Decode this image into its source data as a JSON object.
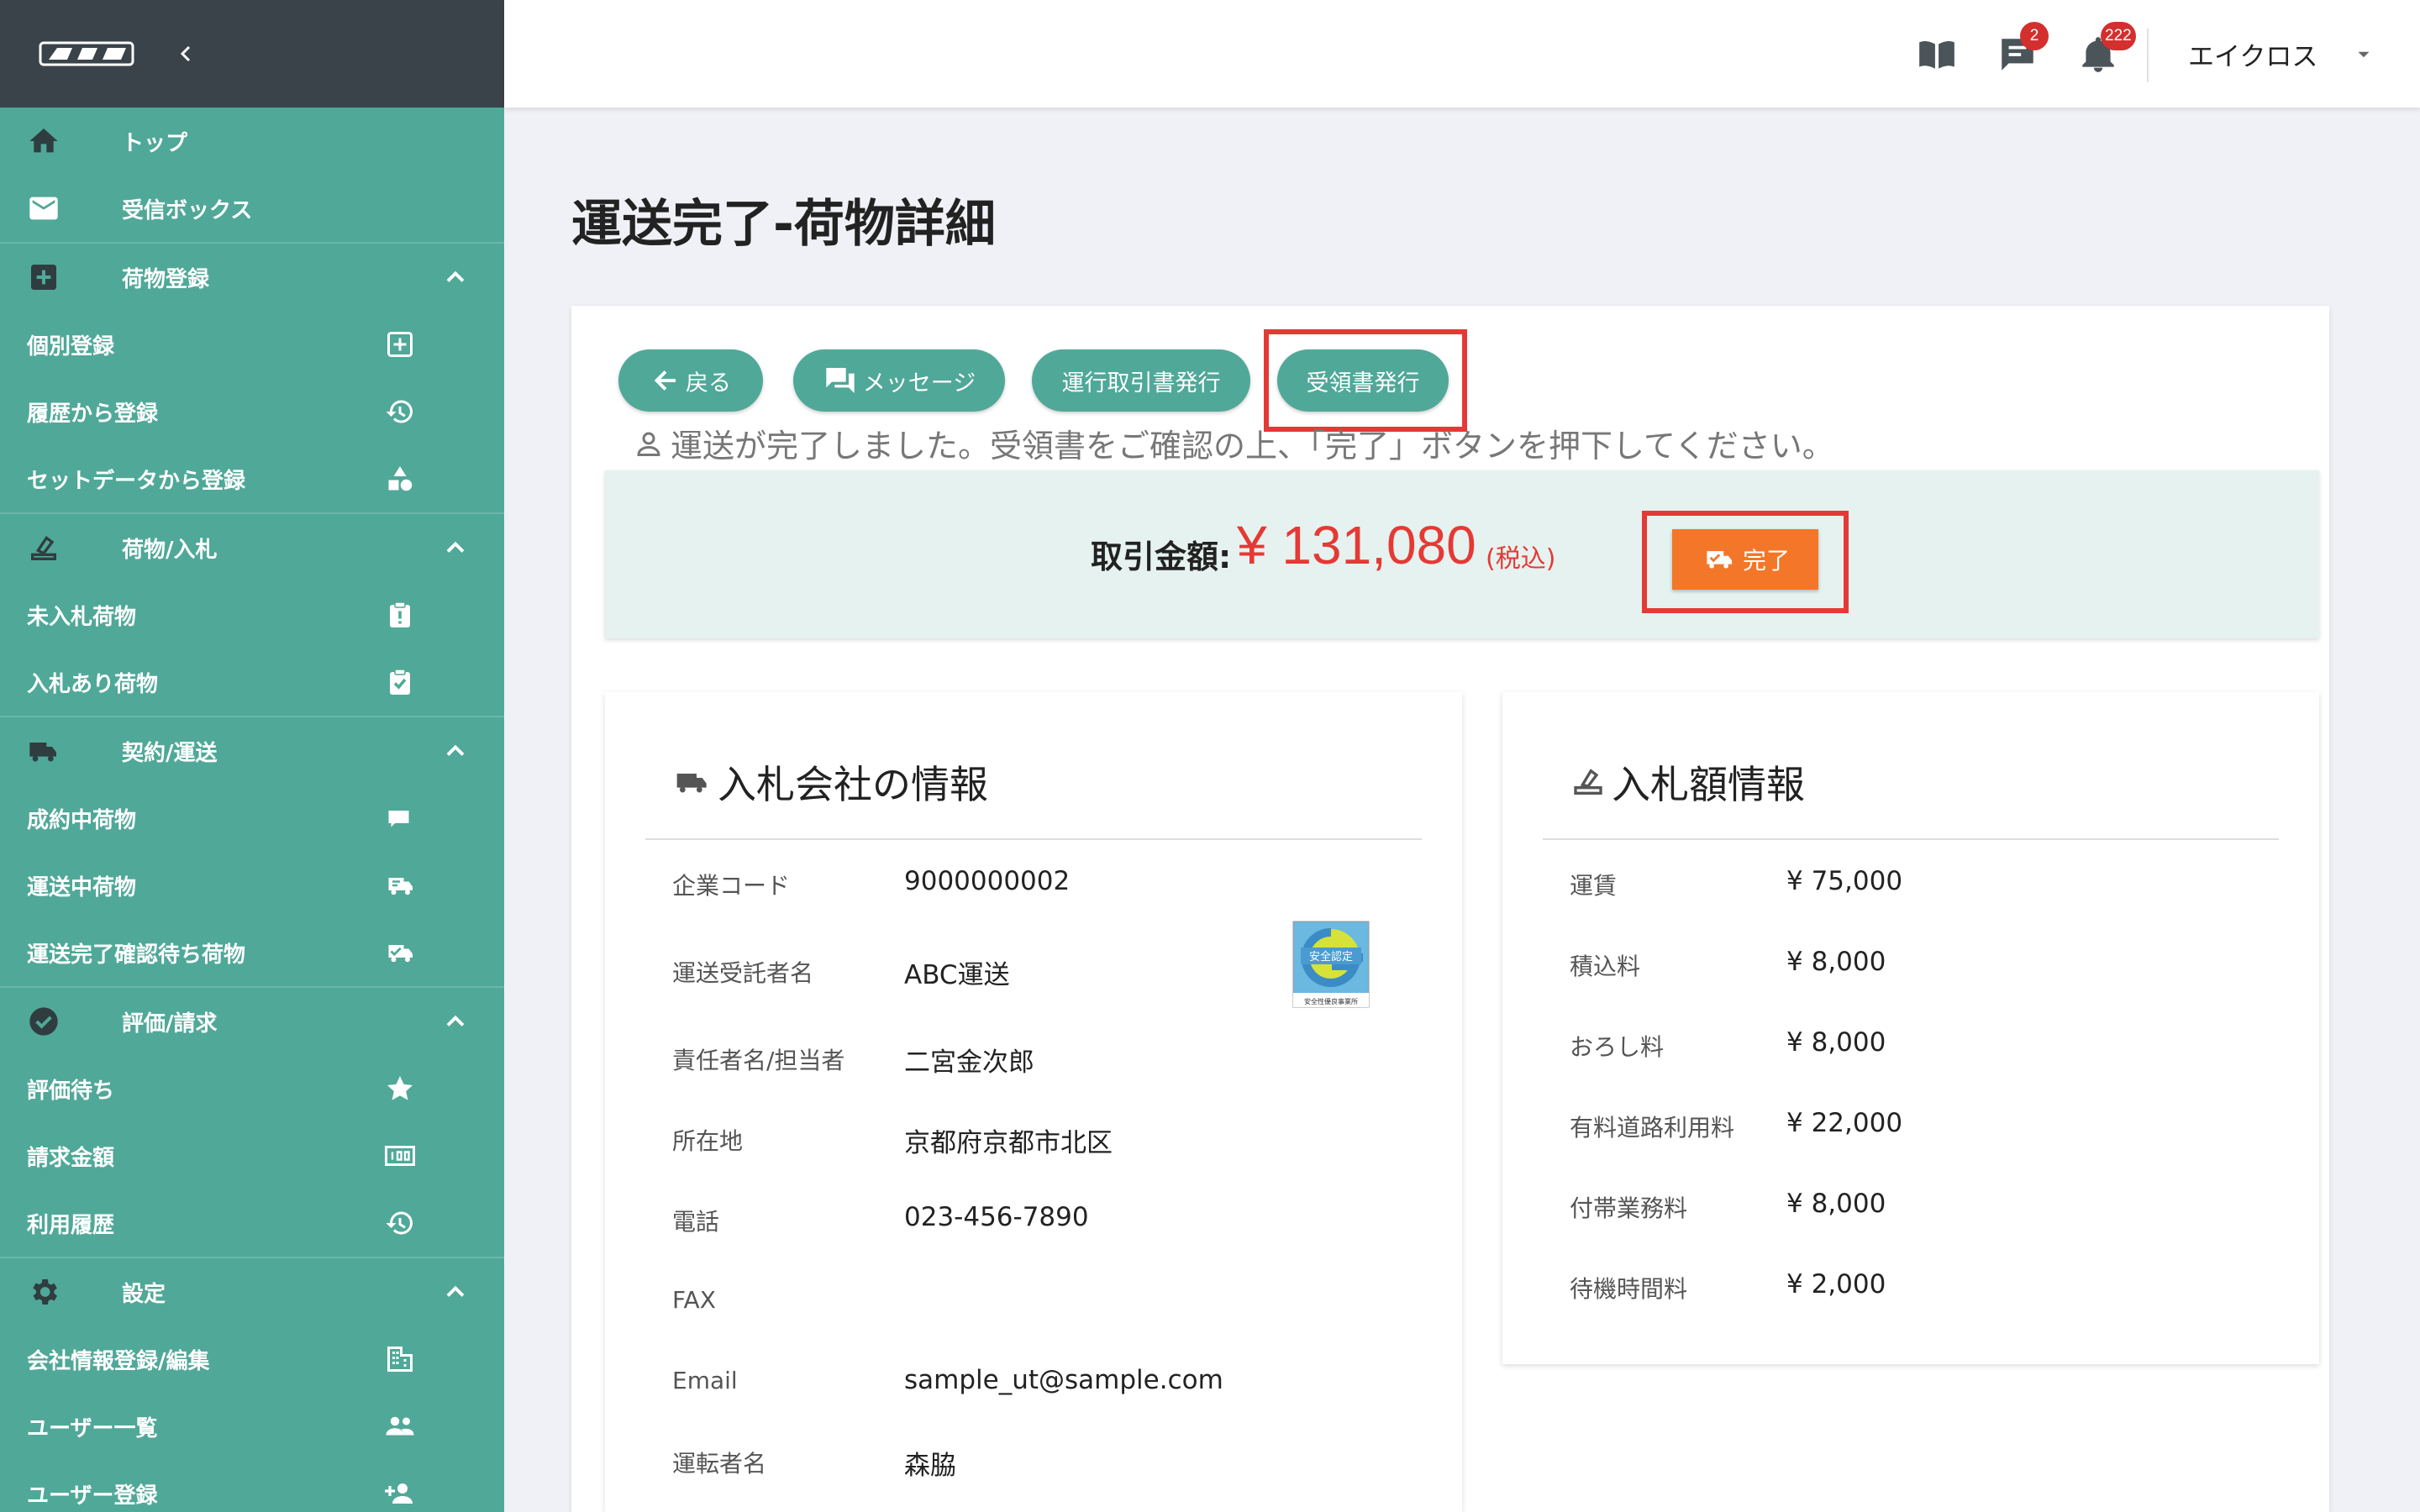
{
  "sidebar": {
    "items": [
      {
        "label": "トップ",
        "icon": "home-icon"
      },
      {
        "label": "受信ボックス",
        "icon": "mail-icon"
      },
      {
        "label": "荷物登録",
        "icon": "plus-box-icon"
      },
      {
        "label": "個別登録",
        "icon": "plus-square-icon"
      },
      {
        "label": "履歴から登録",
        "icon": "history-icon"
      },
      {
        "label": "セットデータから登録",
        "icon": "shapes-icon"
      },
      {
        "label": "荷物/入札",
        "icon": "bid-icon"
      },
      {
        "label": "未入札荷物",
        "icon": "clipboard-alert-icon"
      },
      {
        "label": "入札あり荷物",
        "icon": "clipboard-check-icon"
      },
      {
        "label": "契約/運送",
        "icon": "truck-icon"
      },
      {
        "label": "成約中荷物",
        "icon": "small-truck-icon"
      },
      {
        "label": "運送中荷物",
        "icon": "truck-fast-icon"
      },
      {
        "label": "運送完了確認待ち荷物",
        "icon": "truck-check-icon"
      },
      {
        "label": "評価/請求",
        "icon": "check-circle-icon"
      },
      {
        "label": "評価待ち",
        "icon": "star-icon"
      },
      {
        "label": "請求金額",
        "icon": "counter-icon"
      },
      {
        "label": "利用履歴",
        "icon": "history-icon"
      },
      {
        "label": "設定",
        "icon": "gear-icon"
      },
      {
        "label": "会社情報登録/編集",
        "icon": "building-icon"
      },
      {
        "label": "ユーザー一覧",
        "icon": "users-icon"
      },
      {
        "label": "ユーザー登録",
        "icon": "add-user-icon"
      }
    ]
  },
  "topbar": {
    "messages_badge": "2",
    "notifications_badge": "222",
    "user_name": "エイクロス"
  },
  "page": {
    "title": "運送完了-荷物詳細",
    "buttons": {
      "back": "戻る",
      "message": "メッセージ",
      "transaction_doc": "運行取引書発行",
      "receipt": "受領書発行"
    },
    "notice": "運送が完了しました。受領書をご確認の上、「完了」ボタンを押下してください。",
    "amount_label": "取引金額:",
    "amount_value": "¥ 131,080",
    "amount_tax": "(税込)",
    "done_label": "完了"
  },
  "company_card": {
    "title": "入札会社の情報",
    "rows": [
      {
        "label": "企業コード",
        "value": "9000000002"
      },
      {
        "label": "運送受託者名",
        "value": "ABC運送"
      },
      {
        "label": "責任者名/担当者",
        "value": "二宮金次郎"
      },
      {
        "label": "所在地",
        "value": "京都府京都市北区"
      },
      {
        "label": "電話",
        "value": "023-456-7890"
      },
      {
        "label": "FAX",
        "value": ""
      },
      {
        "label": "Email",
        "value": "sample_ut@sample.com"
      },
      {
        "label": "運転者名",
        "value": "森脇"
      }
    ],
    "safety_mark_text": "安全認定",
    "safety_mark_sub": "安全性優良事業所"
  },
  "bid_card": {
    "title": "入札額情報",
    "rows": [
      {
        "label": "運賃",
        "value": "¥ 75,000"
      },
      {
        "label": "積込料",
        "value": "¥ 8,000"
      },
      {
        "label": "おろし料",
        "value": "¥ 8,000"
      },
      {
        "label": "有料道路利用料",
        "value": "¥ 22,000"
      },
      {
        "label": "付帯業務料",
        "value": "¥ 8,000"
      },
      {
        "label": "待機時間料",
        "value": "¥ 2,000"
      }
    ]
  },
  "colors": {
    "sidebar": "#50a898",
    "sidebar_header": "#3a4349",
    "accent_red": "#e53935",
    "done_orange": "#f47629",
    "highlight_box": "#e53935"
  }
}
